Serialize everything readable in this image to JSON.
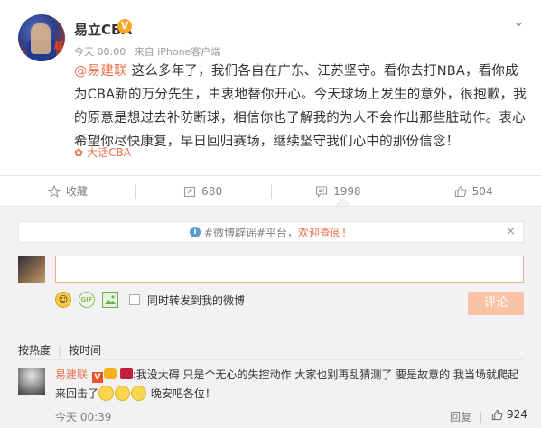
{
  "post": {
    "username": "易立CBA",
    "verified_badge": "V",
    "time": "今天 00:00",
    "via": "来自 iPhone客户端",
    "mention": "@易建联",
    "content": " 这么多年了，我们各自在广东、江苏坚守。看你去打NBA，看你成为CBA新的万分先生，由衷地替你开心。今天球场上发生的意外，很抱歉，我的原意是想过去补防断球，相信你也了解我的为人不会作出那些脏动作。衷心希望你尽快康复，早日回归赛场，继续坚守我们心中的那份信念！",
    "source": "大话CBA",
    "avatar_tag": "赵"
  },
  "actions": {
    "favorite": "收藏",
    "repost": "680",
    "comment": "1998",
    "like": "504"
  },
  "comments_panel": {
    "notice_prefix": "#微博辟谣#平台，",
    "notice_link": "欢迎查阅！",
    "notice_close": "×",
    "forward_label": "同时转发到我的微博",
    "submit_label": "评论",
    "gif_label": "GIF",
    "sort_hot": "按热度",
    "sort_time": "按时间",
    "sort_sep": "|"
  },
  "comment": {
    "name": "易建联",
    "badge_v": "V",
    "text": ":我没大碍 只是个无心的失控动作 大家也别再乱猜测了 要是故意的 我当场就爬起来回击了",
    "text_after": " 晚安吧各位！",
    "time": "今天 00:39",
    "reply": "回复",
    "likes": "924"
  },
  "colors": {
    "accent": "#eb7350",
    "verified": "#f5a623",
    "panel_bg": "#f2f2f5"
  },
  "icons": [
    "chevron-down-icon",
    "star-icon",
    "repost-icon",
    "comment-icon",
    "thumbs-up-icon",
    "info-icon",
    "emoji-icon",
    "gif-icon",
    "image-icon",
    "location-pin-icon"
  ]
}
